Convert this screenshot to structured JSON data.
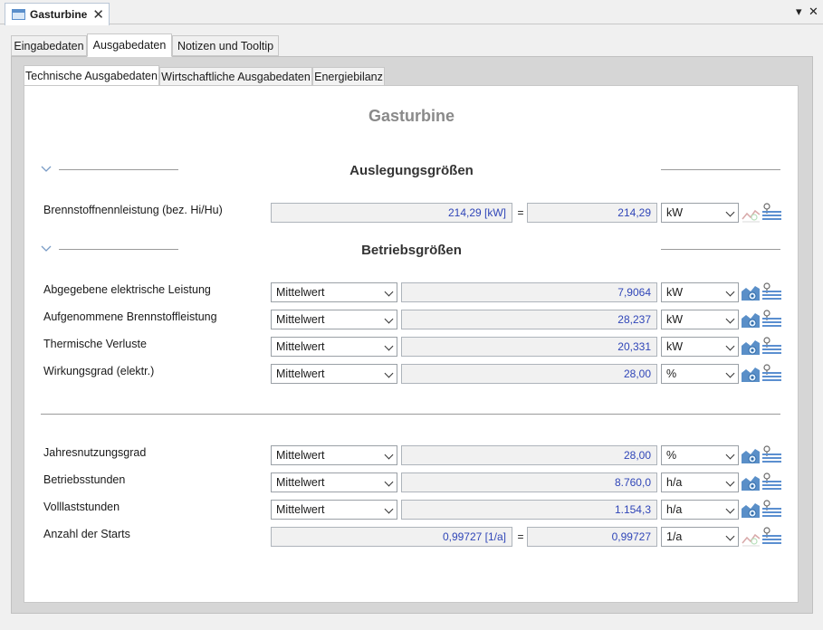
{
  "window": {
    "doc_tab_title": "Gasturbine",
    "close_glyph": "✕",
    "menu_glyph": "▾",
    "window_close_glyph": "✕"
  },
  "tabs": [
    "Eingabedaten",
    "Ausgabedaten",
    "Notizen und Tooltip"
  ],
  "subtabs": [
    "Technische Ausgabedaten",
    "Wirtschaftliche Ausgabedaten",
    "Energiebilanz"
  ],
  "page_title": "Gasturbine",
  "sections": {
    "auslegung": "Auslegungsgrößen",
    "betrieb": "Betriebsgrößen"
  },
  "rows": {
    "brennstoffnennleistung": {
      "label": "Brennstoffnennleistung (bez. Hi/Hu)",
      "formula": "214,29 [kW]",
      "eq": "=",
      "value": "214,29",
      "unit": "kW"
    },
    "elektrische_leistung": {
      "label": "Abgegebene elektrische Leistung",
      "mode": "Mittelwert",
      "value": "7,9064",
      "unit": "kW"
    },
    "brennstoffleistung": {
      "label": "Aufgenommene Brennstoffleistung",
      "mode": "Mittelwert",
      "value": "28,237",
      "unit": "kW"
    },
    "thermische_verluste": {
      "label": "Thermische Verluste",
      "mode": "Mittelwert",
      "value": "20,331",
      "unit": "kW"
    },
    "wirkungsgrad": {
      "label": "Wirkungsgrad (elektr.)",
      "mode": "Mittelwert",
      "value": "28,00",
      "unit": "%"
    },
    "jahresnutzungsgrad": {
      "label": "Jahresnutzungsgrad",
      "mode": "Mittelwert",
      "value": "28,00",
      "unit": "%"
    },
    "betriebsstunden": {
      "label": "Betriebsstunden",
      "mode": "Mittelwert",
      "value": "8.760,0",
      "unit": "h/a"
    },
    "volllaststunden": {
      "label": "Volllaststunden",
      "mode": "Mittelwert",
      "value": "1.154,3",
      "unit": "h/a"
    },
    "starts": {
      "label": "Anzahl der Starts",
      "formula": "0,99727 [1/a]",
      "eq": "=",
      "value": "0,99727",
      "unit": "1/a"
    }
  },
  "icons": {
    "chart_disabled": "line-chart-icon",
    "chart": "area-chart-icon",
    "details": "pin-list-icon"
  },
  "colors": {
    "value_text": "#3046b8",
    "chart_blue": "#5a8fc8",
    "list_blue": "#5b8fd0"
  }
}
